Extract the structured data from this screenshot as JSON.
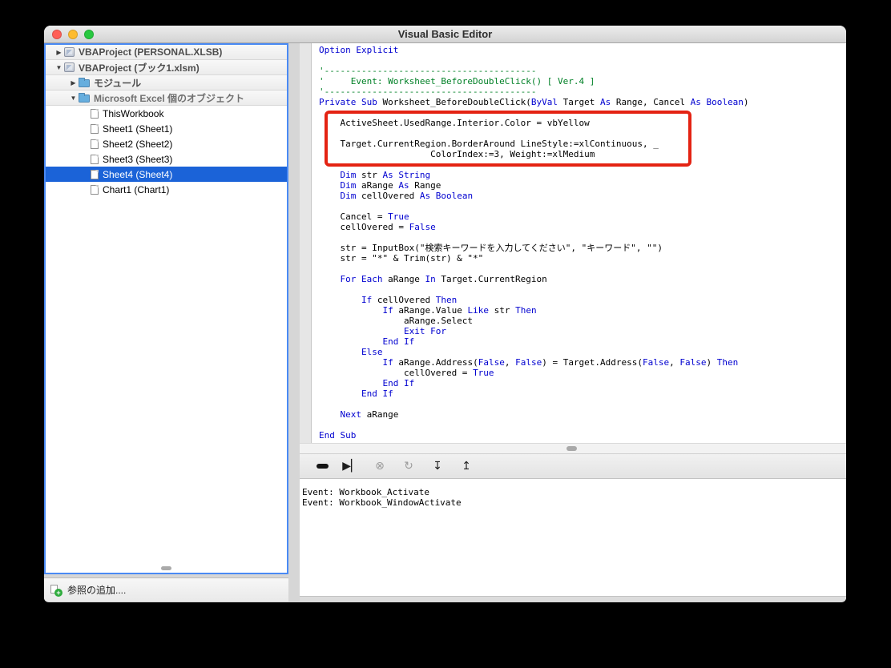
{
  "window": {
    "title": "Visual Basic Editor"
  },
  "traffic_lights": {
    "close": "#ff5f57",
    "minimize": "#febc2e",
    "zoom": "#28c840"
  },
  "project_tree": {
    "selection_color": "#1b63d8",
    "disclosure_glyphs": {
      "collapsed": "▶",
      "expanded": "▼"
    },
    "items": [
      {
        "label": "VBAProject (PERSONAL.XLSB)",
        "level": 0,
        "disclosure": "collapsed",
        "icon": "project",
        "row_style": "group"
      },
      {
        "label": "VBAProject (ブック1.xlsm)",
        "level": 0,
        "disclosure": "expanded",
        "icon": "project",
        "row_style": "group"
      },
      {
        "label": "モジュール",
        "level": 1,
        "disclosure": "collapsed",
        "icon": "folder",
        "row_style": "group"
      },
      {
        "label": "Microsoft Excel 個のオブジェクト",
        "level": 1,
        "disclosure": "expanded",
        "icon": "folder",
        "row_style": "group-gray"
      },
      {
        "label": "ThisWorkbook",
        "level": 2,
        "icon": "sheet"
      },
      {
        "label": "Sheet1 (Sheet1)",
        "level": 2,
        "icon": "sheet"
      },
      {
        "label": "Sheet2 (Sheet2)",
        "level": 2,
        "icon": "sheet"
      },
      {
        "label": "Sheet3 (Sheet3)",
        "level": 2,
        "icon": "sheet"
      },
      {
        "label": "Sheet4 (Sheet4)",
        "level": 2,
        "icon": "sheet",
        "selected": true
      },
      {
        "label": "Chart1 (Chart1)",
        "level": 2,
        "icon": "sheet"
      }
    ]
  },
  "add_reference": {
    "label": "参照の追加...."
  },
  "code_editor": {
    "syntax_colors": {
      "keyword": "#0000d0",
      "comment": "#008026",
      "normal": "#000000"
    },
    "annotation_color": "#e42313",
    "lines": [
      [
        [
          "k",
          "Option Explicit"
        ]
      ],
      [],
      [
        [
          "c",
          "'----------------------------------------"
        ]
      ],
      [
        [
          "c",
          "'     Event: Worksheet_BeforeDoubleClick() [ Ver.4 ]"
        ]
      ],
      [
        [
          "c",
          "'----------------------------------------"
        ]
      ],
      [
        [
          "k",
          "Private Sub"
        ],
        [
          "n",
          " Worksheet_BeforeDoubleClick("
        ],
        [
          "k",
          "ByVal"
        ],
        [
          "n",
          " Target "
        ],
        [
          "k",
          "As"
        ],
        [
          "n",
          " Range, Cancel "
        ],
        [
          "k",
          "As"
        ],
        [
          "n",
          " "
        ],
        [
          "k",
          "Boolean"
        ],
        [
          "n",
          ")"
        ]
      ],
      [],
      [
        [
          "n",
          "    ActiveSheet.UsedRange.Interior.Color = vbYellow"
        ]
      ],
      [],
      [
        [
          "n",
          "    Target.CurrentRegion.BorderAround LineStyle:=xlContinuous, _"
        ]
      ],
      [
        [
          "n",
          "                     ColorIndex:=3, Weight:=xlMedium"
        ]
      ],
      [],
      [
        [
          "n",
          "    "
        ],
        [
          "k",
          "Dim"
        ],
        [
          "n",
          " str "
        ],
        [
          "k",
          "As String"
        ]
      ],
      [
        [
          "n",
          "    "
        ],
        [
          "k",
          "Dim"
        ],
        [
          "n",
          " aRange "
        ],
        [
          "k",
          "As"
        ],
        [
          "n",
          " Range"
        ]
      ],
      [
        [
          "n",
          "    "
        ],
        [
          "k",
          "Dim"
        ],
        [
          "n",
          " cellOvered "
        ],
        [
          "k",
          "As Boolean"
        ]
      ],
      [],
      [
        [
          "n",
          "    Cancel = "
        ],
        [
          "k",
          "True"
        ]
      ],
      [
        [
          "n",
          "    cellOvered = "
        ],
        [
          "k",
          "False"
        ]
      ],
      [],
      [
        [
          "n",
          "    str = InputBox(\"検索キーワードを入力してください\", \"キーワード\", \"\")"
        ]
      ],
      [
        [
          "n",
          "    str = \"*\" & Trim(str) & \"*\""
        ]
      ],
      [],
      [
        [
          "n",
          "    "
        ],
        [
          "k",
          "For Each"
        ],
        [
          "n",
          " aRange "
        ],
        [
          "k",
          "In"
        ],
        [
          "n",
          " Target.CurrentRegion"
        ]
      ],
      [],
      [
        [
          "n",
          "        "
        ],
        [
          "k",
          "If"
        ],
        [
          "n",
          " cellOvered "
        ],
        [
          "k",
          "Then"
        ]
      ],
      [
        [
          "n",
          "            "
        ],
        [
          "k",
          "If"
        ],
        [
          "n",
          " aRange.Value "
        ],
        [
          "k",
          "Like"
        ],
        [
          "n",
          " str "
        ],
        [
          "k",
          "Then"
        ]
      ],
      [
        [
          "n",
          "                aRange.Select"
        ]
      ],
      [
        [
          "n",
          "                "
        ],
        [
          "k",
          "Exit For"
        ]
      ],
      [
        [
          "n",
          "            "
        ],
        [
          "k",
          "End If"
        ]
      ],
      [
        [
          "n",
          "        "
        ],
        [
          "k",
          "Else"
        ]
      ],
      [
        [
          "n",
          "            "
        ],
        [
          "k",
          "If"
        ],
        [
          "n",
          " aRange.Address("
        ],
        [
          "k",
          "False"
        ],
        [
          "n",
          ", "
        ],
        [
          "k",
          "False"
        ],
        [
          "n",
          ") = Target.Address("
        ],
        [
          "k",
          "False"
        ],
        [
          "n",
          ", "
        ],
        [
          "k",
          "False"
        ],
        [
          "n",
          ") "
        ],
        [
          "k",
          "Then"
        ]
      ],
      [
        [
          "n",
          "                cellOvered = "
        ],
        [
          "k",
          "True"
        ]
      ],
      [
        [
          "n",
          "            "
        ],
        [
          "k",
          "End If"
        ]
      ],
      [
        [
          "n",
          "        "
        ],
        [
          "k",
          "End If"
        ]
      ],
      [],
      [
        [
          "n",
          "    "
        ],
        [
          "k",
          "Next"
        ],
        [
          "n",
          " aRange"
        ]
      ],
      [],
      [
        [
          "k",
          "End Sub"
        ]
      ]
    ]
  },
  "debug_toolbar": {
    "buttons": [
      {
        "name": "continue",
        "glyph": "pill",
        "enabled": true
      },
      {
        "name": "run-to-cursor",
        "glyph": "▶▏",
        "enabled": true
      },
      {
        "name": "stop",
        "glyph": "⊗",
        "enabled": false
      },
      {
        "name": "reset",
        "glyph": "↻",
        "enabled": false
      },
      {
        "name": "step-into",
        "glyph": "↧",
        "enabled": true
      },
      {
        "name": "step-out",
        "glyph": "↥",
        "enabled": true
      }
    ]
  },
  "immediate_window": {
    "lines": [
      "Event: Workbook_Activate",
      "Event: Workbook_WindowActivate"
    ]
  }
}
